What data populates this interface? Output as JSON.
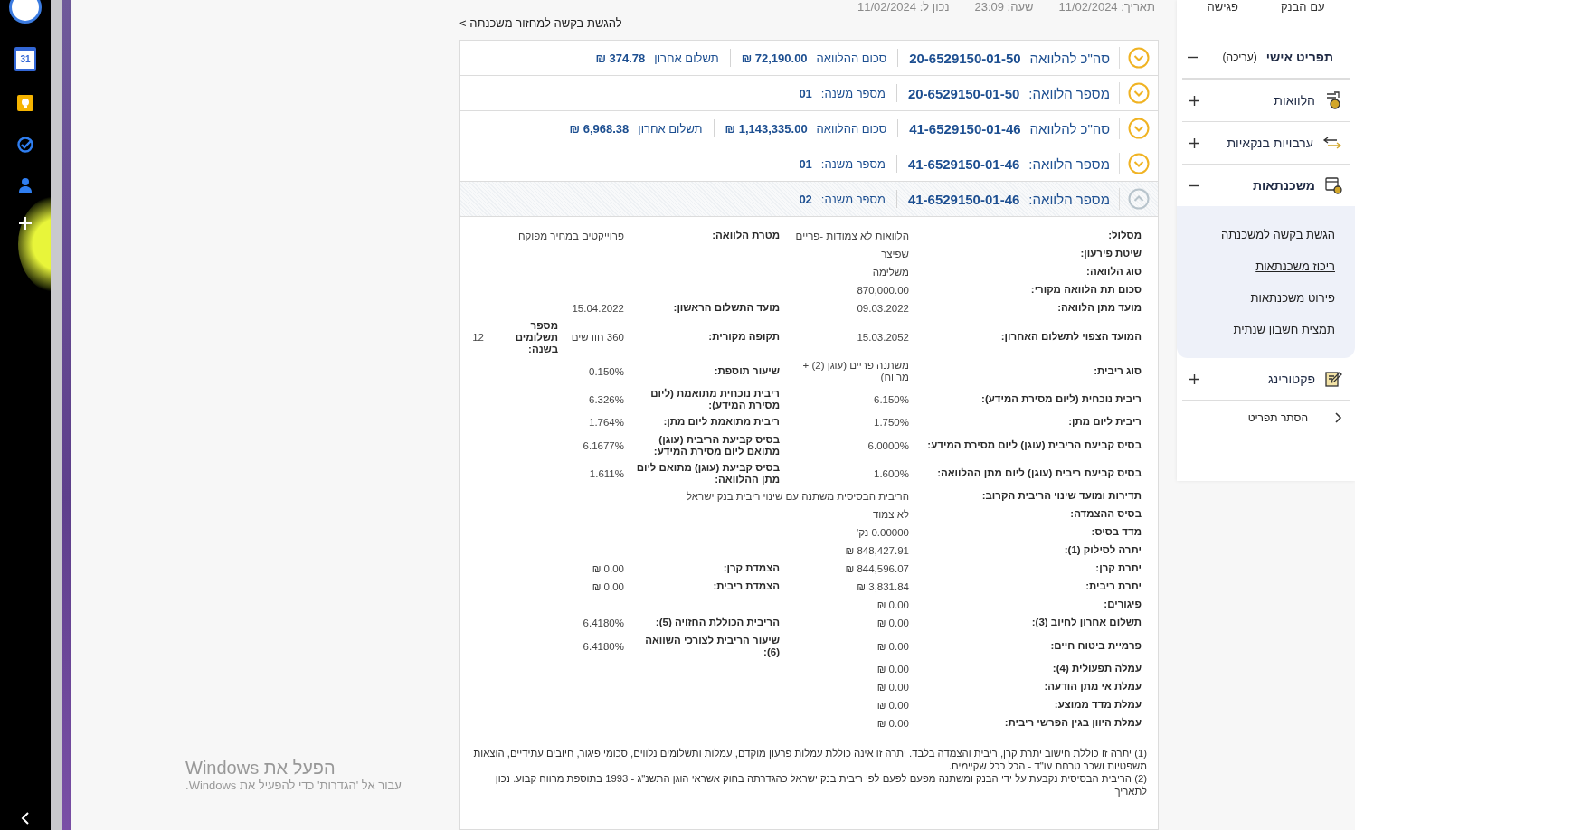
{
  "taskbar": {
    "calendar_day": "31"
  },
  "header": {
    "meta": [
      {
        "label": "תאריך:",
        "value": "11/02/2024"
      },
      {
        "label": "שעה:",
        "value": "23:09"
      },
      {
        "label": "נכון ל:",
        "value": "11/02/2024"
      }
    ],
    "link": "להגשת בקשה למחזור משכנתה >"
  },
  "loans": [
    {
      "title": "סה\"כ להלוואה",
      "number": "20-6529150-01-50",
      "expanded": false,
      "fields": [
        {
          "label": "סכום ההלוואה",
          "value": "72,190.00 ₪"
        },
        {
          "label": "תשלום אחרון",
          "value": "374.78 ₪"
        }
      ]
    },
    {
      "title": "מספר הלוואה:",
      "number": "20-6529150-01-50",
      "expanded": false,
      "fields": [
        {
          "label": "מספר משנה:",
          "value": "01"
        }
      ]
    },
    {
      "title": "סה\"כ להלוואה",
      "number": "41-6529150-01-46",
      "expanded": false,
      "fields": [
        {
          "label": "סכום ההלוואה",
          "value": "1,143,335.00 ₪"
        },
        {
          "label": "תשלום אחרון",
          "value": "6,968.38 ₪"
        }
      ]
    },
    {
      "title": "מספר הלוואה:",
      "number": "41-6529150-01-46",
      "expanded": false,
      "fields": [
        {
          "label": "מספר משנה:",
          "value": "01"
        }
      ]
    },
    {
      "title": "מספר הלוואה:",
      "number": "41-6529150-01-46",
      "expanded": true,
      "fields": [
        {
          "label": "מספר משנה:",
          "value": "02"
        }
      ]
    }
  ],
  "details": {
    "rows": [
      {
        "pairs": [
          {
            "label": "מסלול:",
            "value": "הלוואות לא צמודות -פריים"
          },
          {
            "label": "מטרת הלוואה:",
            "value": "פרוייקטים במחיר מפוקח"
          }
        ]
      },
      {
        "pairs": [
          {
            "label": "שיטת פירעון:",
            "value": "שפיצר"
          }
        ]
      },
      {
        "pairs": [
          {
            "label": "סוג הלוואה:",
            "value": "משלימה"
          }
        ]
      },
      {
        "pairs": [
          {
            "label": "סכום תת הלוואה מקורי:",
            "value": "870,000.00"
          }
        ]
      },
      {
        "pairs": [
          {
            "label": "מועד מתן הלוואה:",
            "value": "09.03.2022"
          },
          {
            "label": "מועד התשלום הראשון:",
            "value": "15.04.2022"
          }
        ]
      },
      {
        "pairs": [
          {
            "label": "המועד הצפוי לתשלום האחרון:",
            "value": "15.03.2052"
          },
          {
            "label": "תקופה מקורית:",
            "value": "360 חודשים"
          },
          {
            "label": "מספר תשלומים בשנה:",
            "value": "12"
          }
        ]
      },
      {
        "pairs": [
          {
            "label": "סוג ריבית:",
            "value": "משתנה פריים (עוגן (2) + מרווח)"
          },
          {
            "label": "שיעור תוספת:",
            "value": "0.150%"
          }
        ]
      },
      {
        "pairs": [
          {
            "label": "ריבית נוכחית (ליום מסירת המידע):",
            "value": "6.150%"
          },
          {
            "label": "ריבית נוכחית מתואמת (ליום מסירת המידע):",
            "value": "6.326%"
          }
        ]
      },
      {
        "pairs": [
          {
            "label": "ריבית ליום מתן:",
            "value": "1.750%"
          },
          {
            "label": "ריבית מתואמת ליום מתן:",
            "value": "1.764%"
          }
        ]
      },
      {
        "pairs": [
          {
            "label": "בסיס קביעת הריבית (עוגן) ליום מסירת המידע:",
            "value": "6.0000%"
          },
          {
            "label": "בסיס קביעת הריבית (עוגן) מתואם ליום מסירת המידע:",
            "value": "6.1677%"
          }
        ]
      },
      {
        "pairs": [
          {
            "label": "בסיס קביעת ריבית (עוגן) ליום מתן ההלוואה:",
            "value": "1.600%"
          },
          {
            "label": "בסיס קביעת (עוגן) מתואם ליום מתן ההלוואה:",
            "value": "1.611%"
          }
        ]
      },
      {
        "pairs": [
          {
            "label": "תדירות ומועד שינוי הריבית הקרוב:",
            "value": "הריבית הבסיסית משתנה עם שינוי ריבית בנק ישראל"
          }
        ]
      },
      {
        "pairs": [
          {
            "label": "בסיס ההצמדה:",
            "value": "לא צמוד"
          }
        ]
      },
      {
        "pairs": [
          {
            "label": "מדד בסיס:",
            "value": "0.00000 נק'"
          }
        ]
      },
      {
        "pairs": [
          {
            "label": "יתרה לסילוק (1):",
            "value": "848,427.91 ₪"
          }
        ]
      },
      {
        "pairs": [
          {
            "label": "יתרת קרן:",
            "value": "844,596.07 ₪"
          },
          {
            "label": "הצמדת קרן:",
            "value": "0.00 ₪"
          }
        ]
      },
      {
        "pairs": [
          {
            "label": "יתרת ריבית:",
            "value": "3,831.84 ₪"
          },
          {
            "label": "הצמדת ריבית:",
            "value": "0.00 ₪"
          }
        ]
      },
      {
        "pairs": [
          {
            "label": "פיגורים:",
            "value": "0.00 ₪"
          }
        ]
      },
      {
        "pairs": [
          {
            "label": "תשלום אחרון לחיוב (3):",
            "value": "0.00 ₪"
          },
          {
            "label": "הריבית הכוללת החזויה (5):",
            "value": "6.4180%"
          }
        ]
      },
      {
        "pairs": [
          {
            "label": "פרמיית ביטוח חיים:",
            "value": "0.00 ₪"
          },
          {
            "label": "שיעור הריבית לצורכי השוואה (6):",
            "value": "6.4180%"
          }
        ]
      },
      {
        "pairs": [
          {
            "label": "עמלה תפעולית (4):",
            "value": "0.00 ₪"
          }
        ]
      },
      {
        "pairs": [
          {
            "label": "עמלת אי מתן הודעה:",
            "value": "0.00 ₪"
          }
        ]
      },
      {
        "pairs": [
          {
            "label": "עמלת מדד ממוצע:",
            "value": "0.00 ₪"
          }
        ]
      },
      {
        "pairs": [
          {
            "label": "עמלת היוון בגין הפרשי ריבית:",
            "value": "0.00 ₪"
          }
        ]
      }
    ],
    "footnotes": [
      "(1) יתרה זו כוללת חישוב יתרת קרן, ריבית והצמדה בלבד. יתרה זו אינה כוללת עמלות פרעון מוקדם, עמלות ותשלומים נלווים, סכומי פיגור, חיובים עתידיים, הוצאות משפטיות ושכר טרחת עו\"ד - הכל ככל שקיימים.",
      "(2) הריבית הבסיסית נקבעת על ידי הבנק ומשתנה מפעם לפעם לפי ריבית בנק ישראל כהגדרתה בחוק אשראי הוגן התשנ\"ג - 1993 בתוספת מרווח קבוע. נכון לתאריך"
    ]
  },
  "sidebar": {
    "top_links": [
      "עם הבנק",
      "פגישה"
    ],
    "items": [
      {
        "label": "תפריט אישי",
        "action": "(עריכה)",
        "expanded": true
      },
      {
        "label": "הלוואות",
        "expanded": false
      },
      {
        "label": "ערבויות בנקאיות",
        "expanded": false
      },
      {
        "label": "משכנתאות",
        "expanded": true,
        "children": [
          {
            "label": "הגשת בקשה למשכנתה",
            "selected": false
          },
          {
            "label": "ריכוז משכנתאות",
            "selected": true
          },
          {
            "label": "פירוט משכנתאות",
            "selected": false
          },
          {
            "label": "תמצית חשבון שנתית",
            "selected": false
          }
        ]
      },
      {
        "label": "פקטורינג",
        "expanded": false
      }
    ],
    "hide_menu": "הסתר תפריט"
  },
  "activation_notice": {
    "title": "הפעל את Windows",
    "text": "עבור אל 'הגדרות' כדי להפעיל את Windows."
  }
}
